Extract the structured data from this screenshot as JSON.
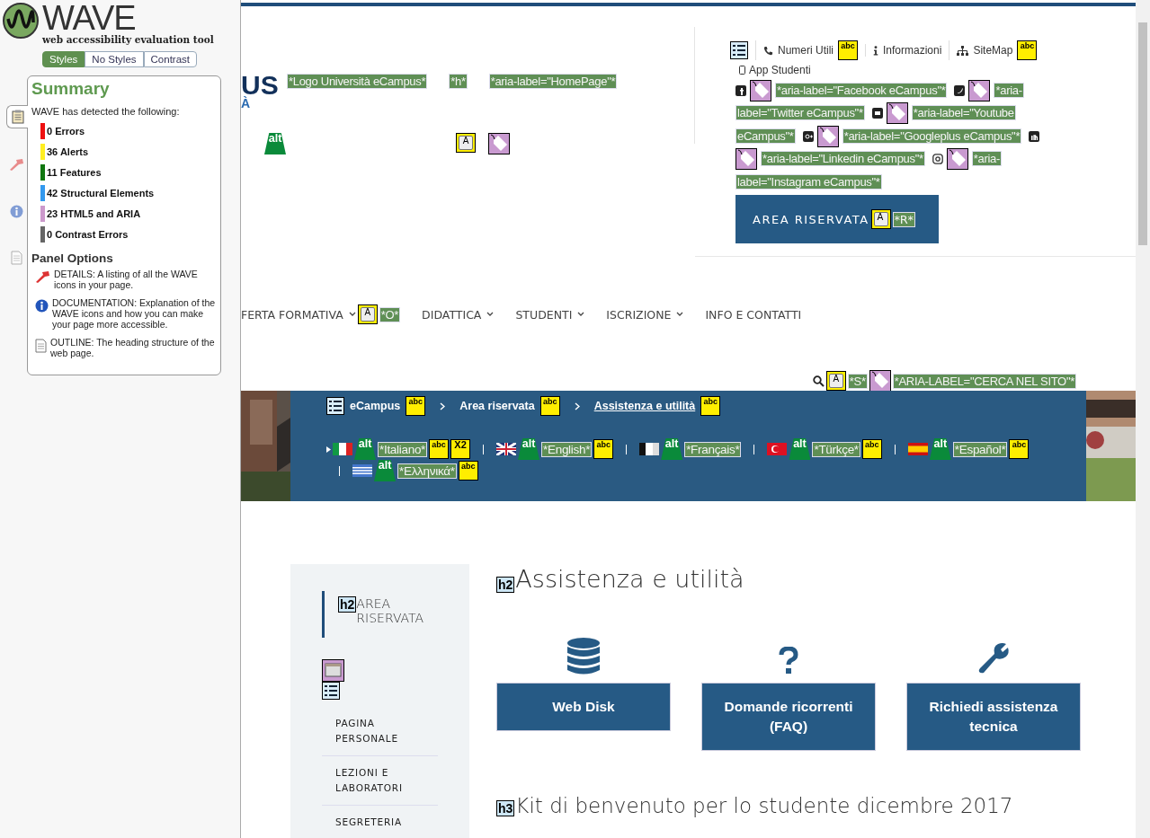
{
  "wave": {
    "title": "WAVE",
    "subtitle": "web accessibility evaluation tool",
    "view_tabs": [
      {
        "label": "Styles",
        "selected": true
      },
      {
        "label": "No Styles",
        "selected": false
      },
      {
        "label": "Contrast",
        "selected": false
      }
    ],
    "side_tabs": [
      {
        "kind": "summary",
        "selected": true
      },
      {
        "kind": "details",
        "selected": false
      },
      {
        "kind": "documentation",
        "selected": false
      },
      {
        "kind": "outline",
        "selected": false
      }
    ],
    "summary": {
      "title": "Summary",
      "intro": "WAVE has detected the following:",
      "items": [
        {
          "label": "0 Errors",
          "color": "#ee1111"
        },
        {
          "label": "36 Alerts",
          "color": "#ffee22"
        },
        {
          "label": "11 Features",
          "color": "#117711"
        },
        {
          "label": "42 Structural Elements",
          "color": "#3399ee"
        },
        {
          "label": "23 HTML5 and ARIA",
          "color": "#cc99cc"
        },
        {
          "label": "0 Contrast Errors",
          "color": "#666666"
        }
      ]
    },
    "panel_options": {
      "title": "Panel Options",
      "items": [
        {
          "kind": "details",
          "text": "DETAILS: A listing of all the WAVE icons in your page."
        },
        {
          "kind": "documentation",
          "text": "DOCUMENTATION: Explanation of the WAVE icons and how you can make your page more accessible."
        },
        {
          "kind": "outline",
          "text": "OUTLINE: The heading structure of the web page."
        }
      ]
    }
  },
  "header": {
    "logo": {
      "line1": "US",
      "line2": "À"
    },
    "annotations": [
      "*Logo Università eCampus*",
      "*h*",
      "*aria-label=\"HomePage\"*"
    ],
    "marks": [
      {
        "kind": "alt",
        "text": "alt"
      },
      {
        "kind": "key",
        "text": "A"
      },
      {
        "kind": "aria"
      }
    ],
    "top_links": [
      {
        "kind": "list"
      },
      {
        "kind": "phone",
        "label": "Numeri Utili",
        "marks": [
          {
            "kind": "alert",
            "text": "abc"
          }
        ]
      },
      {
        "kind": "info",
        "label": "Informazioni"
      },
      {
        "kind": "sitemap",
        "label": "SiteMap",
        "marks": [
          {
            "kind": "alert",
            "text": "abc"
          }
        ]
      }
    ],
    "app_link": {
      "label": "App Studenti"
    },
    "social": [
      {
        "kind": "facebook",
        "label": "*aria-label=\"Facebook eCampus\"*"
      },
      {
        "kind": "twitter",
        "label": "*aria-label=\"Twitter eCampus\"*"
      },
      {
        "kind": "youtube",
        "label": "*aria-label=\"Youtube eCampus\"*"
      },
      {
        "kind": "googleplus",
        "label": "*aria-label=\"Googleplus eCampus\"*"
      },
      {
        "kind": "linkedin",
        "label": "*aria-label=\"Linkedin eCampus\"*"
      },
      {
        "kind": "instagram",
        "label": "*aria-label=\"Instagram eCampus\"*"
      }
    ],
    "area_button": {
      "label": "AREA RISERVATA",
      "marks": [
        {
          "kind": "key",
          "text": "A"
        }
      ],
      "annotation": "*R*"
    }
  },
  "nav": {
    "items": [
      {
        "label": "FERTA FORMATIVA",
        "dropdown": true,
        "marks": [
          {
            "kind": "key",
            "text": "A"
          }
        ],
        "annotation": "*O*"
      },
      {
        "label": "DIDATTICA",
        "dropdown": true
      },
      {
        "label": "STUDENTI",
        "dropdown": true
      },
      {
        "label": "ISCRIZIONE",
        "dropdown": true
      },
      {
        "label": "INFO E CONTATTI",
        "dropdown": false
      }
    ],
    "search": {
      "marks": [
        {
          "kind": "key",
          "text": "A"
        }
      ],
      "annotation": "*S*",
      "aria": "*ARIA-LABEL=\"CERCA NEL SITO\"*"
    }
  },
  "banner": {
    "breadcrumb": [
      {
        "label": "eCampus",
        "current": false,
        "marks": [
          {
            "kind": "alert",
            "text": "abc"
          }
        ]
      },
      {
        "label": "Area riservata",
        "current": false,
        "marks": [
          {
            "kind": "alert",
            "text": "abc"
          }
        ]
      },
      {
        "label": "Assistenza e utilità",
        "current": true,
        "marks": [
          {
            "kind": "alert",
            "text": "abc"
          }
        ]
      }
    ],
    "languages": [
      {
        "kind": "it",
        "selected": true,
        "alt": "alt",
        "label": "*Italiano*",
        "marks": [
          {
            "kind": "alert",
            "text": "abc"
          },
          {
            "kind": "redundant",
            "text": "X2"
          }
        ]
      },
      {
        "kind": "gb",
        "selected": false,
        "alt": "alt",
        "label": "*English*",
        "marks": [
          {
            "kind": "alert",
            "text": "abc"
          }
        ]
      },
      {
        "kind": "fr",
        "selected": false,
        "alt": "alt",
        "label": "*Français*"
      },
      {
        "kind": "tr",
        "selected": false,
        "alt": "alt",
        "label": "*Türkçe*",
        "marks": [
          {
            "kind": "alert",
            "text": "abc"
          }
        ]
      },
      {
        "kind": "es",
        "selected": false,
        "alt": "alt",
        "label": "*Español*",
        "marks": [
          {
            "kind": "alert",
            "text": "abc"
          }
        ]
      },
      {
        "kind": "gr",
        "selected": false,
        "alt": "alt",
        "label": "*Ελληνικά*",
        "marks": [
          {
            "kind": "alert",
            "text": "abc"
          }
        ]
      }
    ]
  },
  "sidebar": {
    "heading": {
      "level": "h2",
      "label": "AREA RISERVATA"
    },
    "items": [
      {
        "label": "PAGINA PERSONALE"
      },
      {
        "label": "LEZIONI E LABORATORI"
      },
      {
        "label": "SEGRETERIA"
      }
    ]
  },
  "main": {
    "heading": {
      "level": "h2",
      "label": "Assistenza e utilità"
    },
    "cards": [
      {
        "kind": "database",
        "label": "Web Disk"
      },
      {
        "kind": "question",
        "label": "Domande ricorrenti (FAQ)"
      },
      {
        "kind": "wrench",
        "label": "Richiedi assistenza tecnica"
      }
    ],
    "subheading": {
      "level": "h3",
      "label": "Kit di benvenuto per lo studente dicembre 2017"
    }
  }
}
